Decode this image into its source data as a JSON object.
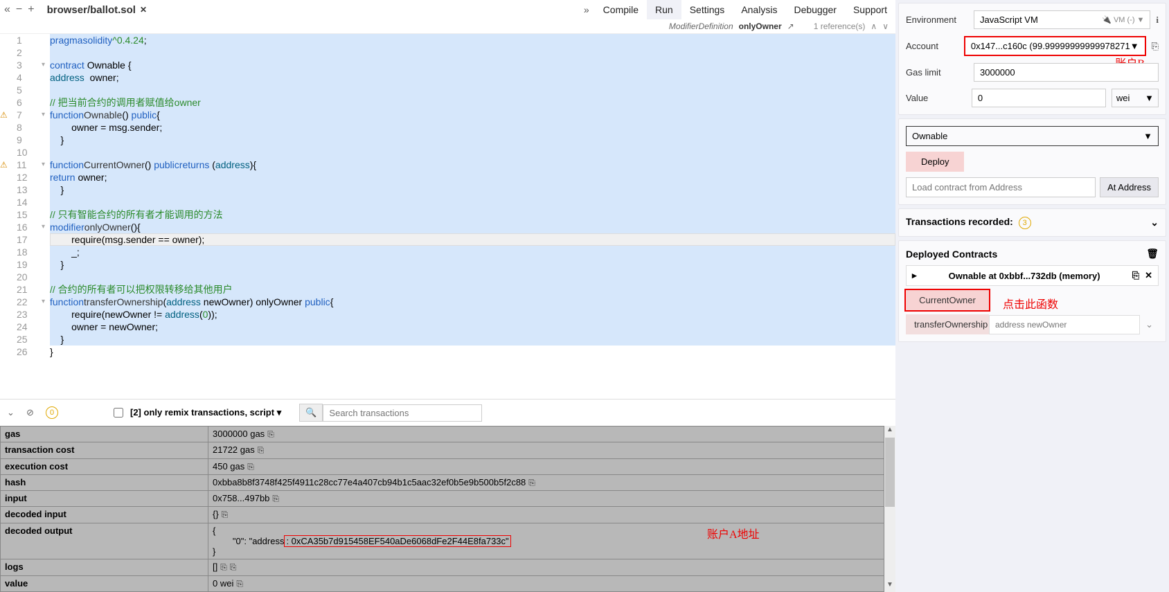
{
  "top": {
    "file_tab": "browser/ballot.sol",
    "nav": [
      "Compile",
      "Run",
      "Settings",
      "Analysis",
      "Debugger",
      "Support"
    ],
    "active_nav": "Run"
  },
  "codeinfo": {
    "kind": "ModifierDefinition",
    "name": "onlyOwner",
    "refs": "1 reference(s)"
  },
  "code": {
    "lines": [
      {
        "n": 1,
        "w": "",
        "f": "",
        "sel": true,
        "html": "<span class='tok-kw'>pragma</span> <span class='tok-kw'>solidity</span> <span class='tok-str'>^0.4.24</span>;"
      },
      {
        "n": 2,
        "w": "",
        "f": "",
        "sel": true,
        "html": ""
      },
      {
        "n": 3,
        "w": "",
        "f": "▾",
        "sel": true,
        "html": "<span class='tok-kw'>contract</span> Ownable {"
      },
      {
        "n": 4,
        "w": "",
        "f": "",
        "sel": true,
        "html": "    <span class='tok-type'>address</span>  owner;"
      },
      {
        "n": 5,
        "w": "",
        "f": "",
        "sel": true,
        "html": ""
      },
      {
        "n": 6,
        "w": "",
        "f": "",
        "sel": true,
        "html": "    <span class='tok-comment'>// 把当前合约的调用者赋值给owner</span>"
      },
      {
        "n": 7,
        "w": "⚠",
        "f": "▾",
        "sel": true,
        "html": "    <span class='tok-kw'>function</span> <span class='tok-fn'>Ownable</span>() <span class='tok-kw'>public</span>{"
      },
      {
        "n": 8,
        "w": "",
        "f": "",
        "sel": true,
        "html": "        owner = msg.sender;"
      },
      {
        "n": 9,
        "w": "",
        "f": "",
        "sel": true,
        "html": "    }"
      },
      {
        "n": 10,
        "w": "",
        "f": "",
        "sel": true,
        "html": ""
      },
      {
        "n": 11,
        "w": "⚠",
        "f": "▾",
        "sel": true,
        "html": "    <span class='tok-kw'>function</span> <span class='tok-fn'>CurrentOwner</span>() <span class='tok-kw'>public</span> <span class='tok-kw'>returns</span> (<span class='tok-type'>address</span>){"
      },
      {
        "n": 12,
        "w": "",
        "f": "",
        "sel": true,
        "html": "        <span class='tok-kw'>return</span> owner;"
      },
      {
        "n": 13,
        "w": "",
        "f": "",
        "sel": true,
        "html": "    }"
      },
      {
        "n": 14,
        "w": "",
        "f": "",
        "sel": true,
        "html": ""
      },
      {
        "n": 15,
        "w": "",
        "f": "",
        "sel": true,
        "html": "    <span class='tok-comment'>// 只有智能合约的所有者才能调用的方法</span>"
      },
      {
        "n": 16,
        "w": "",
        "f": "▾",
        "sel": true,
        "html": "    <span class='tok-kw'>modifier</span> <span class='tok-fn'>onlyOwner</span>(){"
      },
      {
        "n": 17,
        "w": "",
        "f": "",
        "sel": true,
        "cursor": true,
        "html": "        require(msg.sender == owner);"
      },
      {
        "n": 18,
        "w": "",
        "f": "",
        "sel": true,
        "html": "        _;"
      },
      {
        "n": 19,
        "w": "",
        "f": "",
        "sel": true,
        "html": "    }"
      },
      {
        "n": 20,
        "w": "",
        "f": "",
        "sel": true,
        "html": ""
      },
      {
        "n": 21,
        "w": "",
        "f": "",
        "sel": true,
        "html": "    <span class='tok-comment'>// 合约的所有者可以把权限转移给其他用户</span>"
      },
      {
        "n": 22,
        "w": "",
        "f": "▾",
        "sel": true,
        "html": "    <span class='tok-kw'>function</span> <span class='tok-fn'>transferOwnership</span>(<span class='tok-type'>address</span> newOwner) onlyOwner <span class='tok-kw'>public</span>{"
      },
      {
        "n": 23,
        "w": "",
        "f": "",
        "sel": true,
        "html": "        require(newOwner != <span class='tok-type'>address</span>(<span class='tok-num'>0</span>));"
      },
      {
        "n": 24,
        "w": "",
        "f": "",
        "sel": true,
        "html": "        owner = newOwner;"
      },
      {
        "n": 25,
        "w": "",
        "f": "",
        "sel": true,
        "html": "    }"
      },
      {
        "n": 26,
        "w": "",
        "f": "",
        "sel": false,
        "html": "}"
      }
    ]
  },
  "console": {
    "pending": "0",
    "filter_label": "[2] only remix transactions, script",
    "search_placeholder": "Search transactions"
  },
  "tx": {
    "rows": [
      {
        "k": "gas",
        "v": "3000000 gas",
        "copy": true
      },
      {
        "k": "transaction cost",
        "v": "21722 gas",
        "copy": true
      },
      {
        "k": "execution cost",
        "v": "450 gas",
        "copy": true
      },
      {
        "k": "hash",
        "v": "0xbba8b8f3748f425f4911c28cc77e4a407cb94b1c5aac32ef0b5e9b500b5f2c88",
        "copy": true
      },
      {
        "k": "input",
        "v": "0x758...497bb",
        "copy": true
      },
      {
        "k": "decoded input",
        "v": "{}",
        "copy": true
      },
      {
        "k": "decoded output",
        "v_html": "{\n        \"0\": \"address<span class='outbox'>: 0xCA35b7d915458EF540aDe6068dFe2F44E8fa733c\"</span>\n}",
        "copy": false
      },
      {
        "k": "logs",
        "v": "[]",
        "copy": true,
        "copy2": true
      },
      {
        "k": "value",
        "v": "0 wei",
        "copy": true
      }
    ],
    "annot_decoded": "账户A地址"
  },
  "run": {
    "env_label": "Environment",
    "env_value": "JavaScript VM",
    "env_vm": "VM (-)",
    "account_label": "Account",
    "account_value": "0x147...c160c (99.99999999999978271",
    "account_annot": "账户B",
    "gas_label": "Gas limit",
    "gas_value": "3000000",
    "value_label": "Value",
    "value_value": "0",
    "value_unit": "wei",
    "contract_selected": "Ownable",
    "deploy_label": "Deploy",
    "load_placeholder": "Load contract from Address",
    "ataddr_label": "At Address",
    "txrec_label": "Transactions recorded:",
    "txrec_count": "3",
    "deployed_label": "Deployed Contracts",
    "instance_name": "Ownable at 0xbbf...732db (memory)",
    "fn_current": "CurrentOwner",
    "fn_current_annot": "点击此函数",
    "fn_transfer": "transferOwnership",
    "fn_transfer_ph": "address newOwner"
  }
}
